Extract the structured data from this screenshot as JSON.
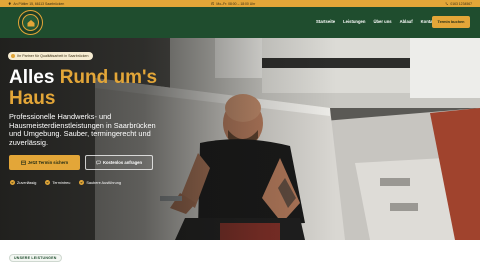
{
  "topbar": {
    "address": "An Püttier 15, 66113 Saarbrücken",
    "hours": "Mo–Fr: 08:00 – 18:00 Uhr",
    "phone": "0163 1234567",
    "icons": {
      "address": "map-pin-icon",
      "hours": "clock-icon",
      "phone": "phone-icon"
    }
  },
  "nav": {
    "logo_icon": "company-logo",
    "items": [
      {
        "label": "Startseite"
      },
      {
        "label": "Leistungen"
      },
      {
        "label": "Über uns"
      },
      {
        "label": "Ablauf"
      },
      {
        "label": "Kontakt"
      }
    ],
    "cta_label": "Termin buchen"
  },
  "hero": {
    "badge": "Ihr Partner für Qualitätsarbeit in Saarbrücken",
    "headline_part1": "Alles ",
    "headline_part2": "Rund um's",
    "headline_part3": "Haus",
    "subline": "Professionelle Handwerks- und Hausmeisterdienstleistungen in Saarbrücken und Umgebung. Sauber, termingerecht und zuverlässig.",
    "primary_button": "Jetzt Termin sichern",
    "secondary_button": "Kostenlos anfragen",
    "features": [
      {
        "label": "Zuverlässig"
      },
      {
        "label": "Termintreu"
      },
      {
        "label": "Saubere Ausführung"
      }
    ]
  },
  "services": {
    "pill": "UNSERE LEISTUNGEN"
  },
  "colors": {
    "accent": "#e3a638",
    "primary_green": "#1f4d2e"
  }
}
